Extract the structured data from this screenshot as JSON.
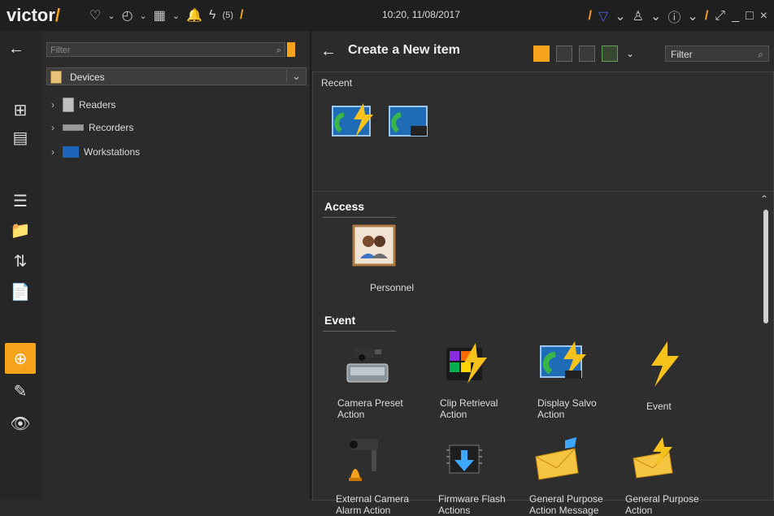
{
  "topbar": {
    "logo": "victor",
    "slash": "/",
    "alarm_count": "(5)",
    "clock": "10:20, 11/08/2017",
    "icons": [
      "heart-icon",
      "dashboard-icon",
      "grid-icon",
      "bell-off-icon",
      "lightning-icon",
      "slash",
      "filter-icon",
      "user-icon",
      "help-icon",
      "slash",
      "resize-icon",
      "minimize-icon",
      "maximize-icon",
      "close-icon"
    ]
  },
  "leftpane": {
    "filter_placeholder": "Filter",
    "devices_label": "Devices",
    "tree": [
      {
        "label": "Readers"
      },
      {
        "label": "Recorders"
      },
      {
        "label": "Workstations"
      }
    ]
  },
  "rightpane": {
    "title": "Create a New item",
    "filter_placeholder": "Filter",
    "recent_label": "Recent",
    "sections": [
      {
        "name": "Access",
        "items": [
          {
            "label": "Personnel"
          }
        ]
      },
      {
        "name": "Event",
        "items": [
          {
            "label": "Camera Preset\nAction"
          },
          {
            "label": "Clip Retrieval\nAction"
          },
          {
            "label": "Display Salvo\nAction"
          },
          {
            "label": "Event"
          },
          {
            "label": "External Camera\nAlarm Action"
          },
          {
            "label": "Firmware Flash\nActions"
          },
          {
            "label": "General Purpose\nAction Message"
          },
          {
            "label": "General Purpose\nAction"
          }
        ]
      }
    ]
  },
  "colors": {
    "accent": "#f6a21a",
    "background": "#2b2b2b",
    "topbar": "#1f1f1f"
  }
}
